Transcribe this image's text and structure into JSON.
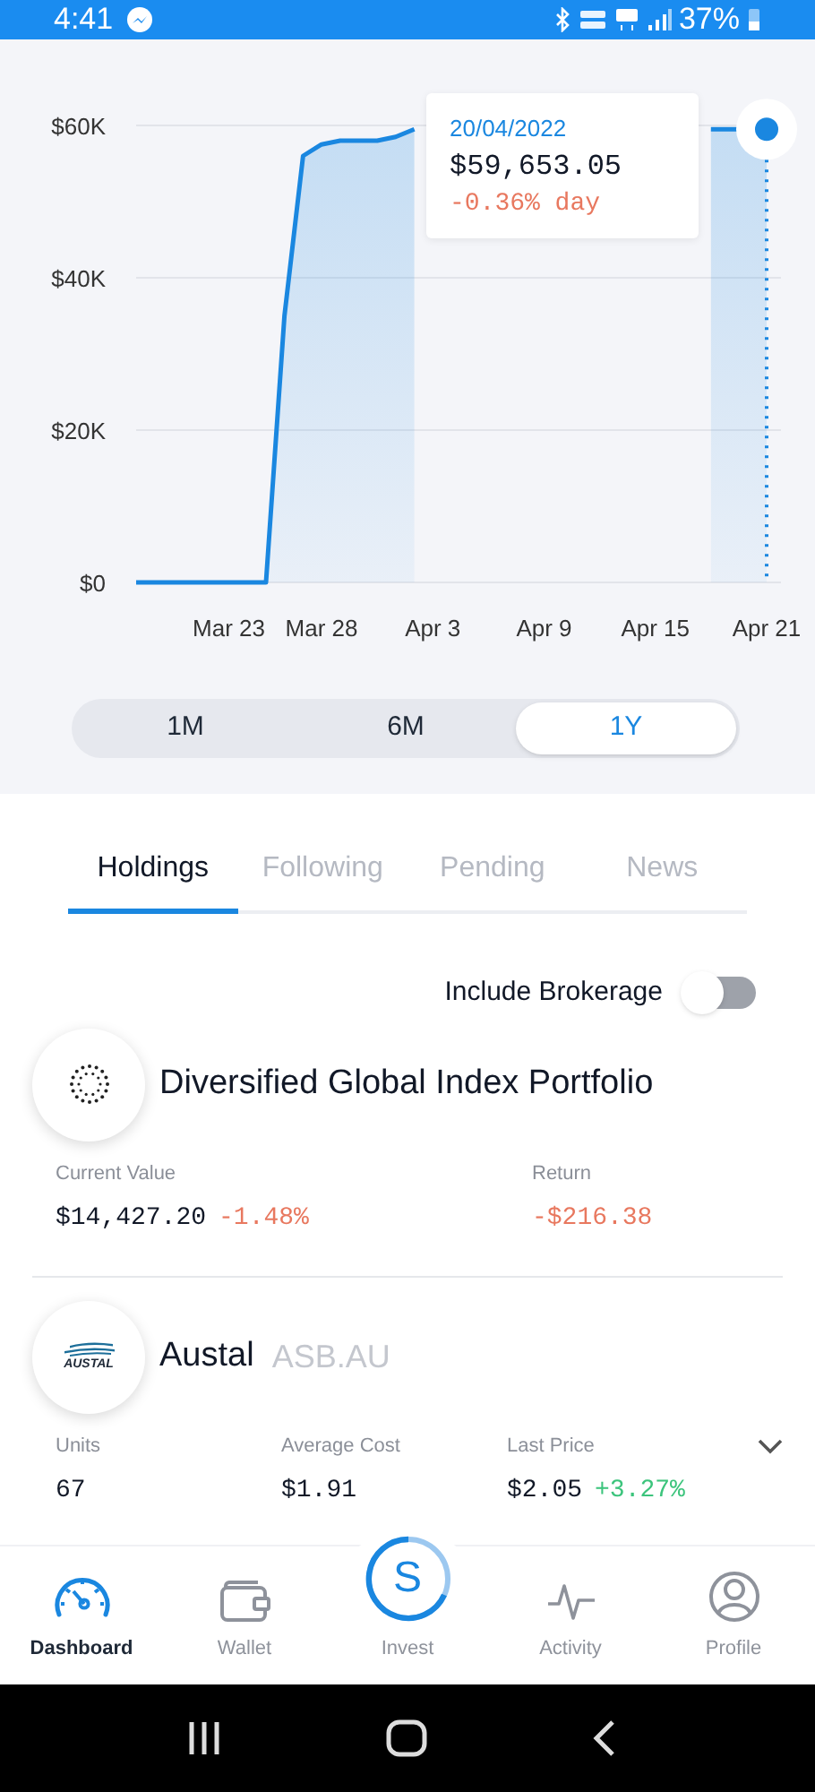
{
  "status_bar": {
    "time": "4:41",
    "battery": "37%"
  },
  "chart": {
    "tooltip": {
      "date": "20/04/2022",
      "value": "$59,653.05",
      "change": "-0.36% day"
    },
    "chart_data": {
      "type": "area",
      "categories": [
        null,
        null,
        null,
        null,
        null,
        "Mar 23",
        null,
        null,
        null,
        null,
        "Mar 28",
        null,
        null,
        null,
        null,
        null,
        "Apr 3",
        null,
        null,
        null,
        null,
        null,
        "Apr 9",
        null,
        null,
        null,
        null,
        null,
        "Apr 15",
        null,
        null,
        null,
        null,
        null,
        "Apr 21"
      ],
      "series": [
        {
          "color": "#1a87e0",
          "values": [
            0,
            0,
            0,
            0,
            0,
            0,
            0,
            0,
            35000,
            56000,
            57500,
            58000,
            58000,
            58000,
            58500,
            59500,
            null,
            null,
            null,
            null,
            null,
            null,
            null,
            null,
            null,
            null,
            null,
            null,
            null,
            null,
            null,
            59500,
            59500,
            59500,
            59500
          ]
        }
      ],
      "ylim": [
        0,
        60000
      ],
      "grid": true,
      "yticks": [
        {
          "value": 0,
          "label": "$0"
        },
        {
          "value": 20000,
          "label": "$20K"
        },
        {
          "value": 40000,
          "label": "$40K"
        },
        {
          "value": 60000,
          "label": "$60K"
        }
      ]
    }
  },
  "ranges": [
    {
      "label": "1M",
      "selected": false
    },
    {
      "label": "6M",
      "selected": false
    },
    {
      "label": "1Y",
      "selected": true
    }
  ],
  "tabs": [
    {
      "label": "Holdings",
      "selected": true
    },
    {
      "label": "Following",
      "selected": false
    },
    {
      "label": "Pending",
      "selected": false
    },
    {
      "label": "News",
      "selected": false
    }
  ],
  "include_brokerage": {
    "label": "Include Brokerage",
    "on": false
  },
  "holdings": [
    {
      "kind": "portfolio",
      "name": "Diversified Global Index Portfolio",
      "stats": [
        {
          "label": "Current Value",
          "value": "$14,427.20",
          "change": "-1.48%",
          "negative": true
        },
        {
          "label": "Return",
          "value": "-$216.38",
          "negative": true
        }
      ]
    },
    {
      "kind": "stock",
      "name": "Austal",
      "ticker": "ASB.AU",
      "logo_text": "AUSTAL",
      "expanded": false,
      "stats": [
        {
          "label": "Units",
          "value": "67"
        },
        {
          "label": "Average Cost",
          "value": "$1.91"
        },
        {
          "label": "Last Price",
          "value": "$2.05",
          "change": "+3.27%",
          "negative": false
        }
      ]
    }
  ],
  "bottom_nav": [
    {
      "kind": "dashboard",
      "label": "Dashboard",
      "selected": true
    },
    {
      "kind": "wallet",
      "label": "Wallet",
      "selected": false
    },
    {
      "kind": "invest",
      "label": "Invest",
      "logo_letter": "S",
      "selected": false
    },
    {
      "kind": "activity",
      "label": "Activity",
      "selected": false
    },
    {
      "kind": "profile",
      "label": "Profile",
      "selected": false
    }
  ]
}
